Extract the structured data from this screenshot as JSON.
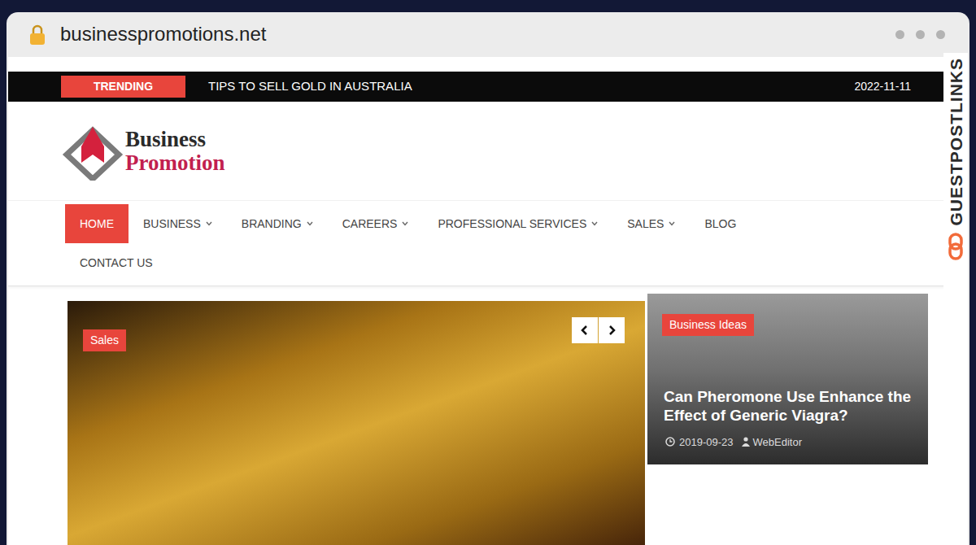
{
  "browser": {
    "url": "businesspromotions.net",
    "secure": true
  },
  "watermark": {
    "text": "GUESTPOSTLINKS"
  },
  "topbar": {
    "trending_label": "TRENDING",
    "trending_text": "TIPS TO SELL GOLD IN AUSTRALIA",
    "date": "2022-11-11"
  },
  "logo": {
    "line1": "Business",
    "line2": "Promotion"
  },
  "nav": [
    {
      "label": "HOME",
      "selected": true,
      "dropdown": false
    },
    {
      "label": "BUSINESS",
      "selected": false,
      "dropdown": true
    },
    {
      "label": "BRANDING",
      "selected": false,
      "dropdown": true
    },
    {
      "label": "CAREERS",
      "selected": false,
      "dropdown": true
    },
    {
      "label": "PROFESSIONAL SERVICES",
      "selected": false,
      "dropdown": true
    },
    {
      "label": "SALES",
      "selected": false,
      "dropdown": true
    },
    {
      "label": "BLOG",
      "selected": false,
      "dropdown": false
    },
    {
      "label": "CONTACT US",
      "selected": false,
      "dropdown": false
    }
  ],
  "slider": {
    "tag": "Sales"
  },
  "side_post": {
    "tag": "Business Ideas",
    "title": "Can Pheromone Use Enhance the Effect of Generic Viagra?",
    "date": "2019-09-23",
    "author": "WebEditor"
  }
}
